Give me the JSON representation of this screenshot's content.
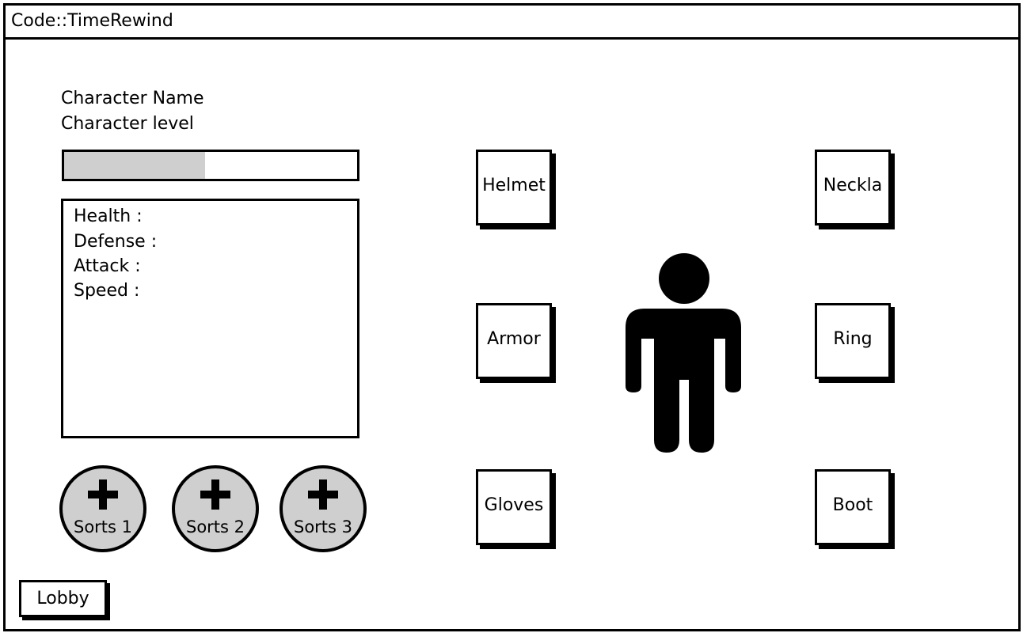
{
  "window": {
    "title": "Code::TimeRewind"
  },
  "character": {
    "name_label": "Character Name",
    "level_label": "Character level",
    "xp_progress": 0.48
  },
  "stats": {
    "lines": [
      "Health :",
      "Defense :",
      "Attack :",
      "Speed :"
    ]
  },
  "sorts": [
    {
      "label": "Sorts 1",
      "icon": "plus-icon"
    },
    {
      "label": "Sorts 2",
      "icon": "plus-icon"
    },
    {
      "label": "Sorts 3",
      "icon": "plus-icon"
    }
  ],
  "equipment": {
    "helmet": "Helmet",
    "necklace": "Neckla",
    "armor": "Armor",
    "ring": "Ring",
    "gloves": "Gloves",
    "boot": "Boot"
  },
  "avatar_icon": "person-icon",
  "footer": {
    "lobby_label": "Lobby"
  },
  "colors": {
    "fill_gray": "#cfcfcf",
    "border": "#000000"
  }
}
